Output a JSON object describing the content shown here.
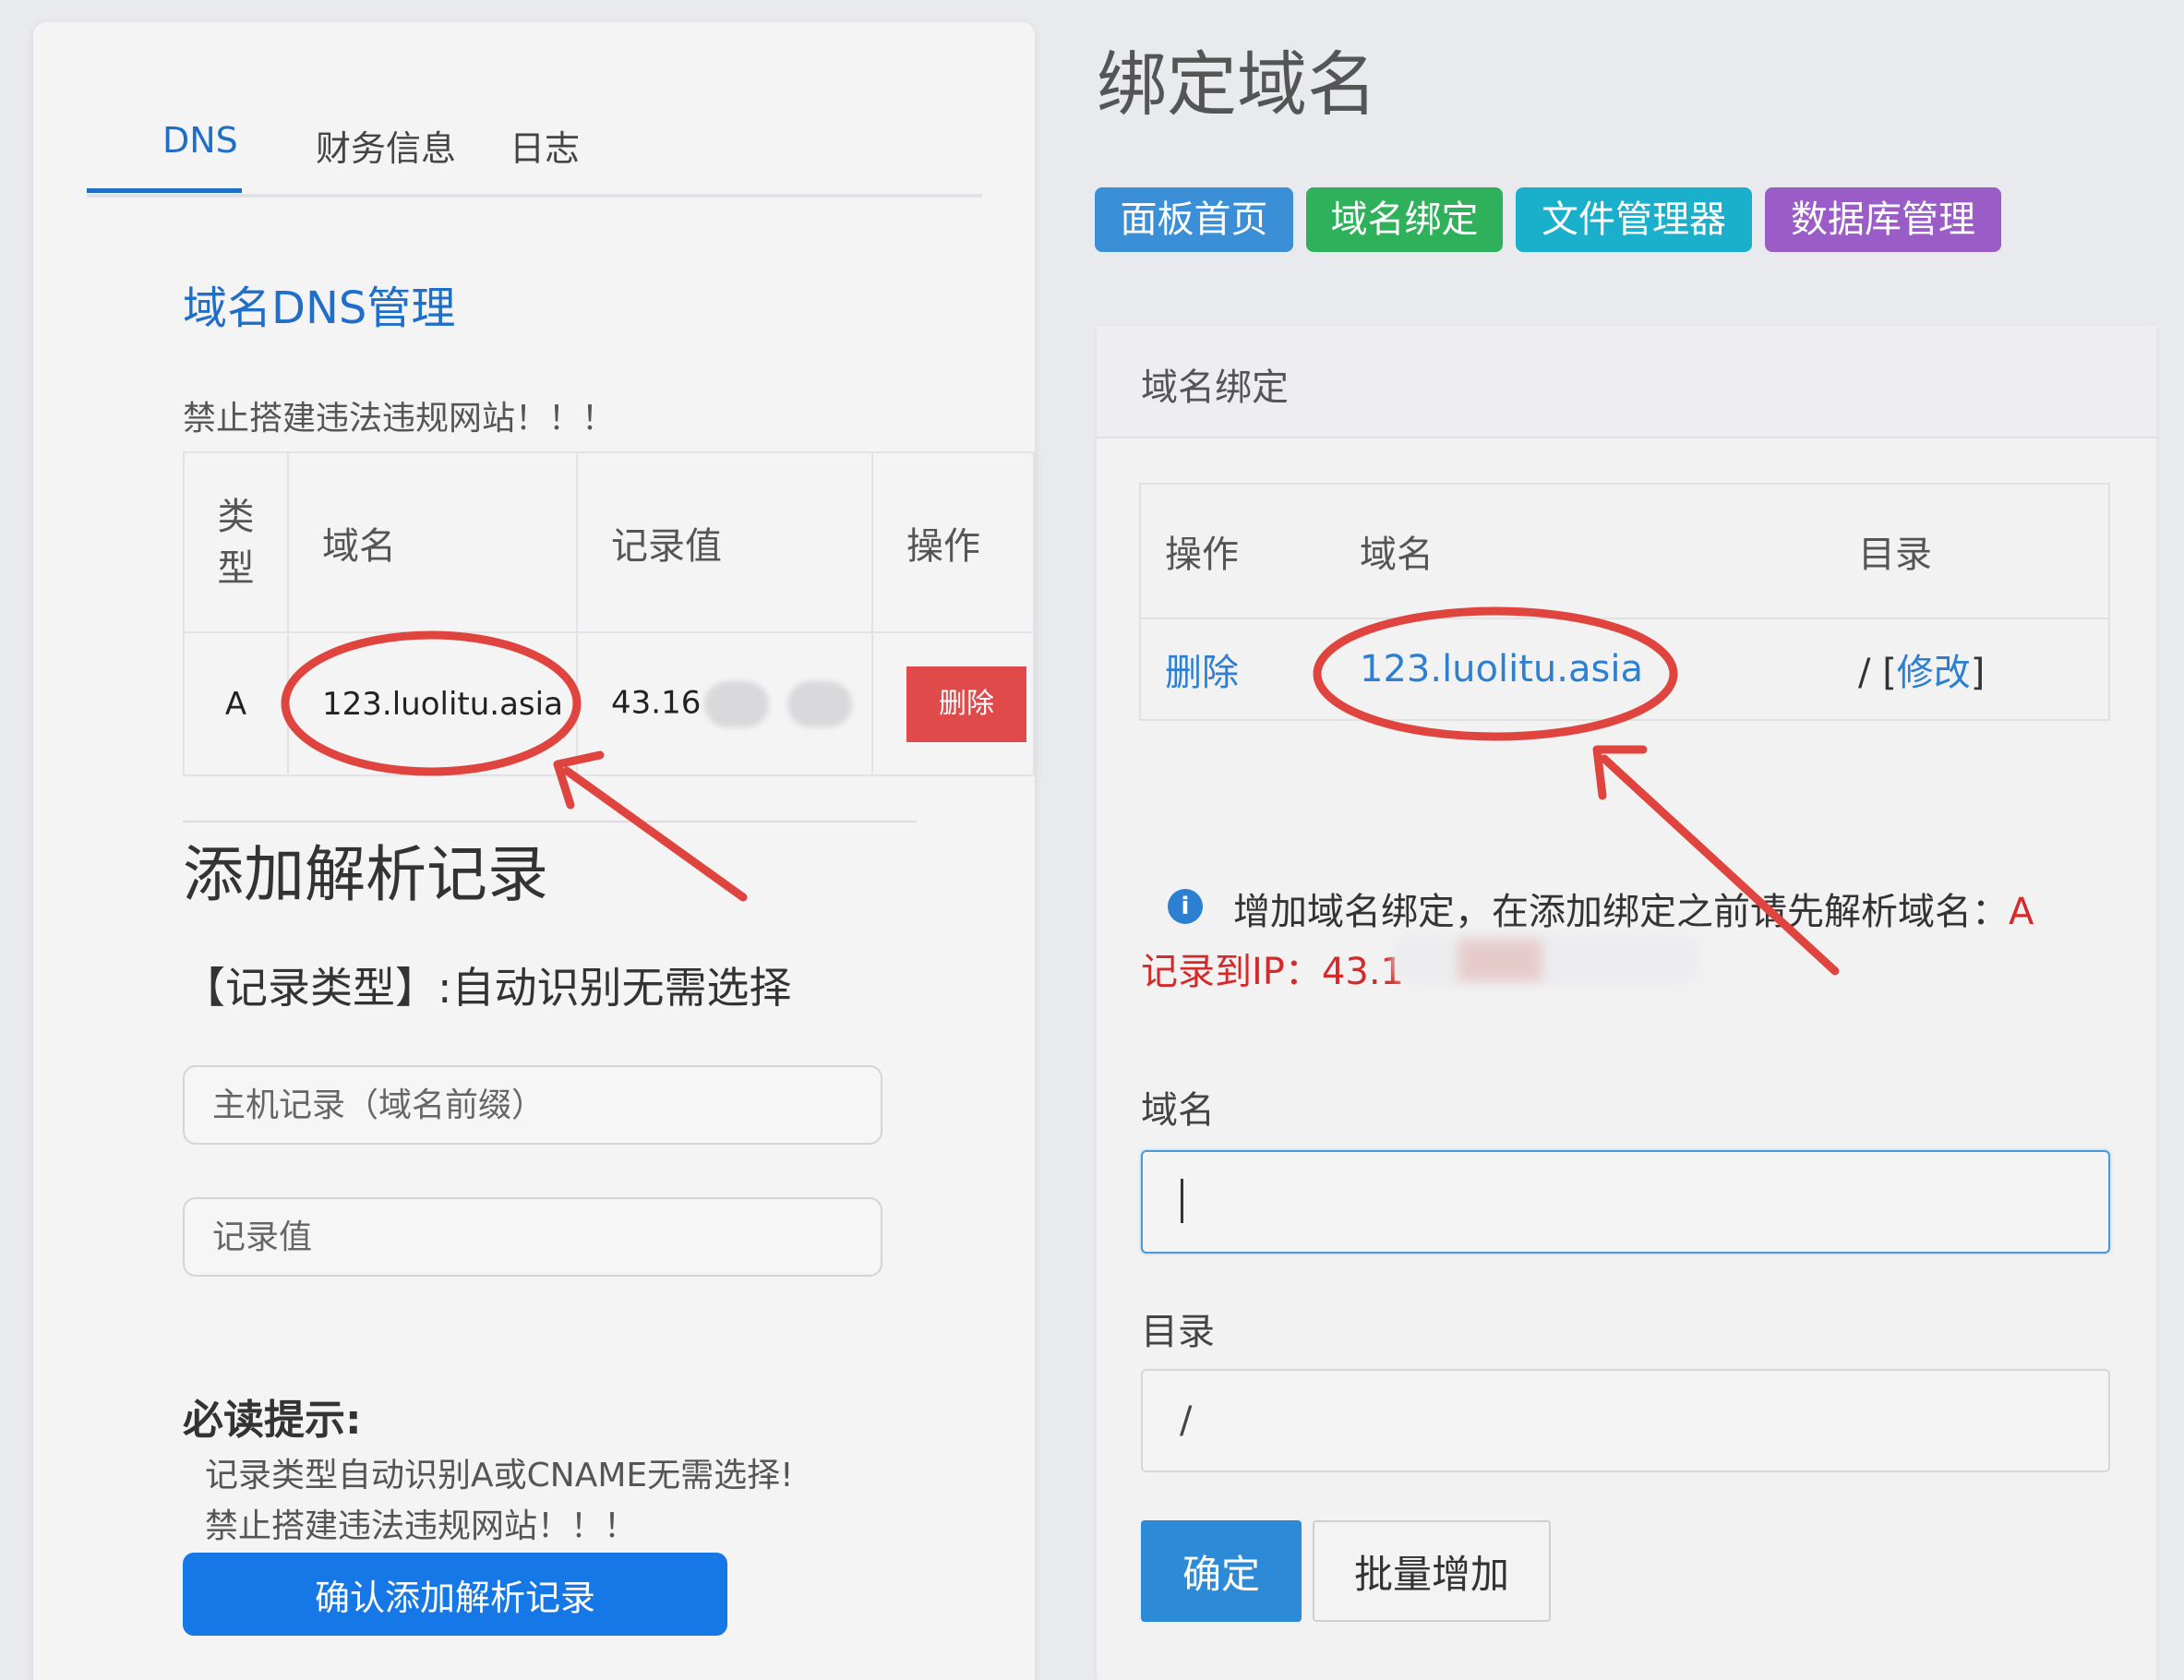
{
  "left": {
    "tabs": [
      {
        "label": "DNS",
        "active": true
      },
      {
        "label": "财务信息",
        "active": false
      },
      {
        "label": "日志",
        "active": false
      }
    ],
    "section_title": "域名DNS管理",
    "warning": "禁止搭建违法违规网站！！！",
    "table": {
      "headers": [
        "类型",
        "域名",
        "记录值",
        "操作"
      ],
      "headers_type_line1": "类",
      "headers_type_line2": "型",
      "rows": [
        {
          "type": "A",
          "domain": "123.luolitu.asia",
          "value": "43.16",
          "action": "删除"
        }
      ]
    },
    "add_title": "添加解析记录",
    "record_type_hint": "【记录类型】:自动识别无需选择",
    "host_placeholder": "主机记录（域名前缀）",
    "value_placeholder": "记录值",
    "must_read_title": "必读提示:",
    "must_read_lines": [
      "记录类型自动识别A或CNAME无需选择!",
      "禁止搭建违法违规网站！！！"
    ],
    "confirm_button": "确认添加解析记录"
  },
  "right": {
    "page_title": "绑定域名",
    "nav_buttons": [
      {
        "label": "面板首页",
        "color": "#3a8fd6"
      },
      {
        "label": "域名绑定",
        "color": "#2fb05a"
      },
      {
        "label": "文件管理器",
        "color": "#1ab0cc"
      },
      {
        "label": "数据库管理",
        "color": "#9a5cc6"
      }
    ],
    "panel_title": "域名绑定",
    "table": {
      "headers": [
        "操作",
        "域名",
        "目录"
      ],
      "rows": [
        {
          "action": "删除",
          "domain": "123.luolitu.asia",
          "dir_prefix": "/ [",
          "dir_link": "修改",
          "dir_suffix": "]"
        }
      ]
    },
    "info_text": "增加域名绑定，在添加绑定之前请先解析域名：",
    "info_red_tail": "A",
    "info_line2": "记录到IP：43.1",
    "domain_label": "域名",
    "domain_value": "",
    "dir_label": "目录",
    "dir_value": "/",
    "ok_button": "确定",
    "batch_button": "批量增加"
  },
  "annotation_color": "#e0443e"
}
